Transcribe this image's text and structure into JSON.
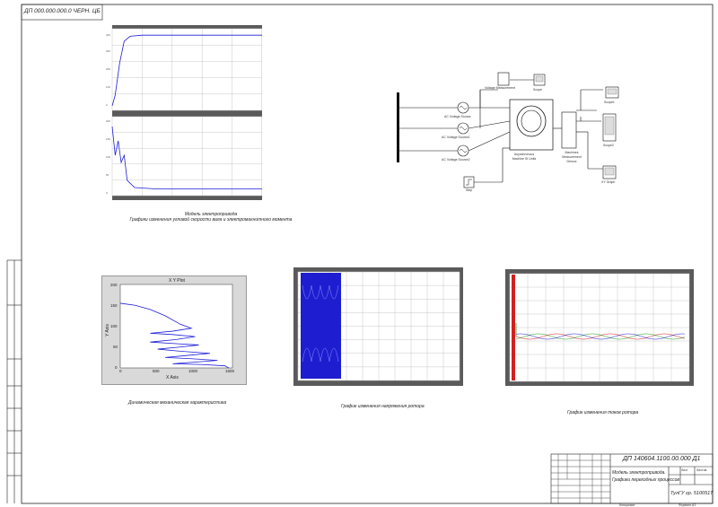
{
  "stamp_top": "ДП 000.000.000.0 ЧЕРН. ЦБ",
  "caption_model": {
    "line1": "Модель электропривода",
    "line2": "Графики изменения угловой скорости вала и электромагнитного момента"
  },
  "caption_xy": "Динамическая механическая характеристика",
  "caption_voltage": "График изменения напряжения ротора",
  "caption_currents": "График изменения токов ротора",
  "xy_plot": {
    "title": "X Y Plot",
    "xlabel": "X Axis",
    "ylabel": "Y Axis",
    "xticks": [
      "0",
      "500",
      "1000",
      "1500"
    ],
    "yticks": [
      "200",
      "150",
      "100",
      "50",
      "0"
    ]
  },
  "simulink": {
    "blocks": {
      "src1": "AC Voltage Source",
      "src2": "AC Voltage Source1",
      "src3": "AC Voltage Source2",
      "vmeas": "Voltage Measurement",
      "scope": "Scope",
      "machine": "Asynchronous Machine SI Units",
      "demux": "Machines Measurement Demux",
      "scope1": "Scope1",
      "scope2": "Scope2",
      "xy": "XY Graph",
      "step": "Step"
    }
  },
  "title_block": {
    "designation": "ДП 140604.1100.00.000 Д1",
    "name_line1": "Модель электропривода.",
    "name_line2": "Графики переходных процессов",
    "org": "ТулГУ гр. 510051Т",
    "sheet_label": "Лист",
    "sheets_label": "Листов",
    "copied": "Копировал",
    "format": "Формат А1"
  },
  "chart_data": [
    {
      "type": "line",
      "name": "speed",
      "x": [
        0,
        0.02,
        0.05,
        0.08,
        0.12,
        0.2,
        0.5,
        1.0
      ],
      "values": [
        0,
        0.15,
        0.6,
        0.9,
        0.97,
        0.985,
        0.985,
        0.985
      ]
    },
    {
      "type": "line",
      "name": "torque",
      "x": [
        0,
        0.02,
        0.04,
        0.06,
        0.08,
        0.1,
        0.15,
        0.3,
        1.0
      ],
      "values": [
        0.9,
        0.5,
        0.7,
        0.4,
        0.5,
        0.15,
        0.05,
        0.03,
        0.03
      ]
    },
    {
      "type": "line",
      "title": "X Y Plot",
      "xlabel": "X Axis",
      "ylabel": "Y Axis",
      "xlim": [
        0,
        1500
      ],
      "ylim": [
        0,
        200
      ],
      "points": [
        [
          0,
          155
        ],
        [
          200,
          150
        ],
        [
          400,
          140
        ],
        [
          600,
          125
        ],
        [
          800,
          105
        ],
        [
          950,
          95
        ],
        [
          700,
          88
        ],
        [
          400,
          83
        ],
        [
          700,
          80
        ],
        [
          1000,
          75
        ],
        [
          750,
          68
        ],
        [
          400,
          62
        ],
        [
          750,
          58
        ],
        [
          1050,
          55
        ],
        [
          800,
          50
        ],
        [
          500,
          45
        ],
        [
          800,
          40
        ],
        [
          1200,
          35
        ],
        [
          900,
          30
        ],
        [
          600,
          25
        ],
        [
          950,
          22
        ],
        [
          1300,
          18
        ],
        [
          1000,
          14
        ],
        [
          700,
          10
        ],
        [
          1100,
          8
        ],
        [
          1400,
          5
        ],
        [
          1450,
          0
        ]
      ]
    }
  ]
}
